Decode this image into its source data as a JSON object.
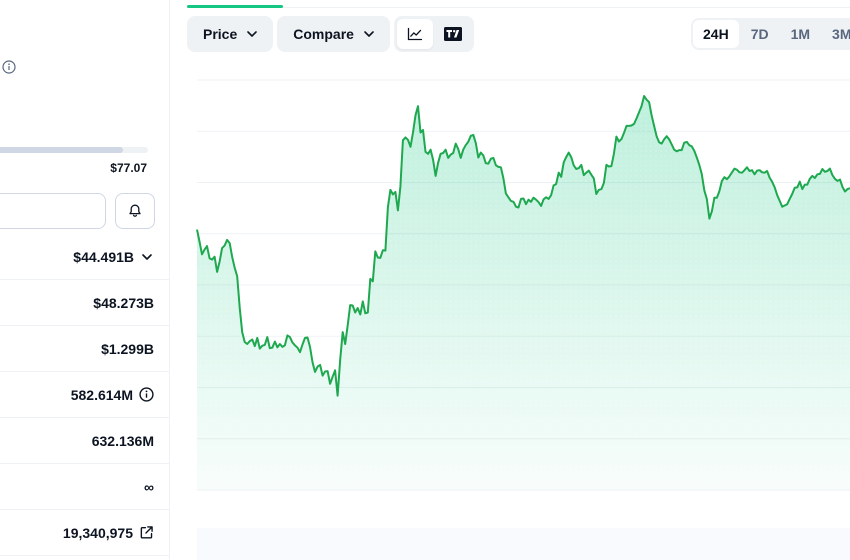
{
  "stats": {
    "range_bar_fill_fraction": 0.83,
    "range_high": "$77.07",
    "rows": [
      {
        "value": "$44.491B",
        "icon": "chevron-down-icon"
      },
      {
        "value": "$48.273B",
        "icon": ""
      },
      {
        "value": "$1.299B",
        "icon": ""
      },
      {
        "value": "582.614M",
        "icon": "info-icon"
      },
      {
        "value": "632.136M",
        "icon": ""
      },
      {
        "value": "∞",
        "icon": ""
      },
      {
        "value": "19,340,975",
        "icon": "external-link-icon"
      }
    ]
  },
  "toolbar": {
    "price_label": "Price",
    "compare_label": "Compare",
    "chart_type_options": [
      "line-chart-icon",
      "tradingview-icon"
    ],
    "selected_chart_type": "line-chart-icon",
    "ranges": [
      "24H",
      "7D",
      "1M",
      "3M"
    ],
    "selected_range": "24H"
  },
  "colors": {
    "line": "#16c784",
    "line_dark": "#1ea84f",
    "grid": "#eff2f5",
    "accent_tab": "#16c784"
  },
  "chart_data": {
    "type": "area",
    "gridlines": 9,
    "y": [
      0.635,
      0.606,
      0.575,
      0.586,
      0.595,
      0.565,
      0.562,
      0.569,
      0.532,
      0.557,
      0.59,
      0.596,
      0.61,
      0.602,
      0.568,
      0.542,
      0.521,
      0.445,
      0.385,
      0.361,
      0.356,
      0.363,
      0.367,
      0.351,
      0.371,
      0.345,
      0.352,
      0.354,
      0.373,
      0.346,
      0.347,
      0.362,
      0.348,
      0.356,
      0.349,
      0.353,
      0.377,
      0.373,
      0.36,
      0.353,
      0.347,
      0.336,
      0.355,
      0.371,
      0.372,
      0.349,
      0.312,
      0.288,
      0.301,
      0.305,
      0.279,
      0.289,
      0.29,
      0.259,
      0.276,
      0.292,
      0.23,
      0.318,
      0.385,
      0.356,
      0.402,
      0.451,
      0.45,
      0.433,
      0.444,
      0.428,
      0.46,
      0.431,
      0.433,
      0.515,
      0.509,
      0.582,
      0.567,
      0.566,
      0.585,
      0.584,
      0.69,
      0.732,
      0.721,
      0.727,
      0.682,
      0.74,
      0.853,
      0.86,
      0.854,
      0.837,
      0.872,
      0.914,
      0.936,
      0.872,
      0.878,
      0.825,
      0.82,
      0.83,
      0.805,
      0.766,
      0.798,
      0.82,
      0.822,
      0.83,
      0.81,
      0.818,
      0.822,
      0.845,
      0.832,
      0.81,
      0.83,
      0.841,
      0.849,
      0.864,
      0.866,
      0.846,
      0.811,
      0.823,
      0.816,
      0.797,
      0.796,
      0.808,
      0.81,
      0.792,
      0.788,
      0.787,
      0.76,
      0.723,
      0.714,
      0.705,
      0.703,
      0.691,
      0.689,
      0.71,
      0.711,
      0.697,
      0.708,
      0.703,
      0.713,
      0.708,
      0.702,
      0.693,
      0.709,
      0.714,
      0.71,
      0.719,
      0.743,
      0.746,
      0.774,
      0.764,
      0.799,
      0.812,
      0.823,
      0.812,
      0.792,
      0.783,
      0.785,
      0.793,
      0.768,
      0.774,
      0.779,
      0.769,
      0.76,
      0.722,
      0.732,
      0.734,
      0.749,
      0.793,
      0.789,
      0.79,
      0.82,
      0.862,
      0.85,
      0.856,
      0.871,
      0.888,
      0.888,
      0.889,
      0.893,
      0.906,
      0.921,
      0.936,
      0.961,
      0.952,
      0.946,
      0.914,
      0.888,
      0.863,
      0.848,
      0.845,
      0.855,
      0.863,
      0.855,
      0.843,
      0.83,
      0.826,
      0.829,
      0.829,
      0.847,
      0.849,
      0.841,
      0.838,
      0.827,
      0.811,
      0.793,
      0.77,
      0.731,
      0.71,
      0.662,
      0.68,
      0.713,
      0.713,
      0.729,
      0.754,
      0.763,
      0.758,
      0.765,
      0.775,
      0.784,
      0.781,
      0.775,
      0.774,
      0.78,
      0.787,
      0.778,
      0.78,
      0.77,
      0.779,
      0.78,
      0.775,
      0.774,
      0.778,
      0.762,
      0.752,
      0.738,
      0.719,
      0.705,
      0.691,
      0.694,
      0.697,
      0.71,
      0.722,
      0.737,
      0.738,
      0.752,
      0.734,
      0.745,
      0.745,
      0.759,
      0.766,
      0.761,
      0.77,
      0.771,
      0.783,
      0.776,
      0.778,
      0.784,
      0.768,
      0.759,
      0.754,
      0.757,
      0.739,
      0.728,
      0.734,
      0.736
    ]
  }
}
